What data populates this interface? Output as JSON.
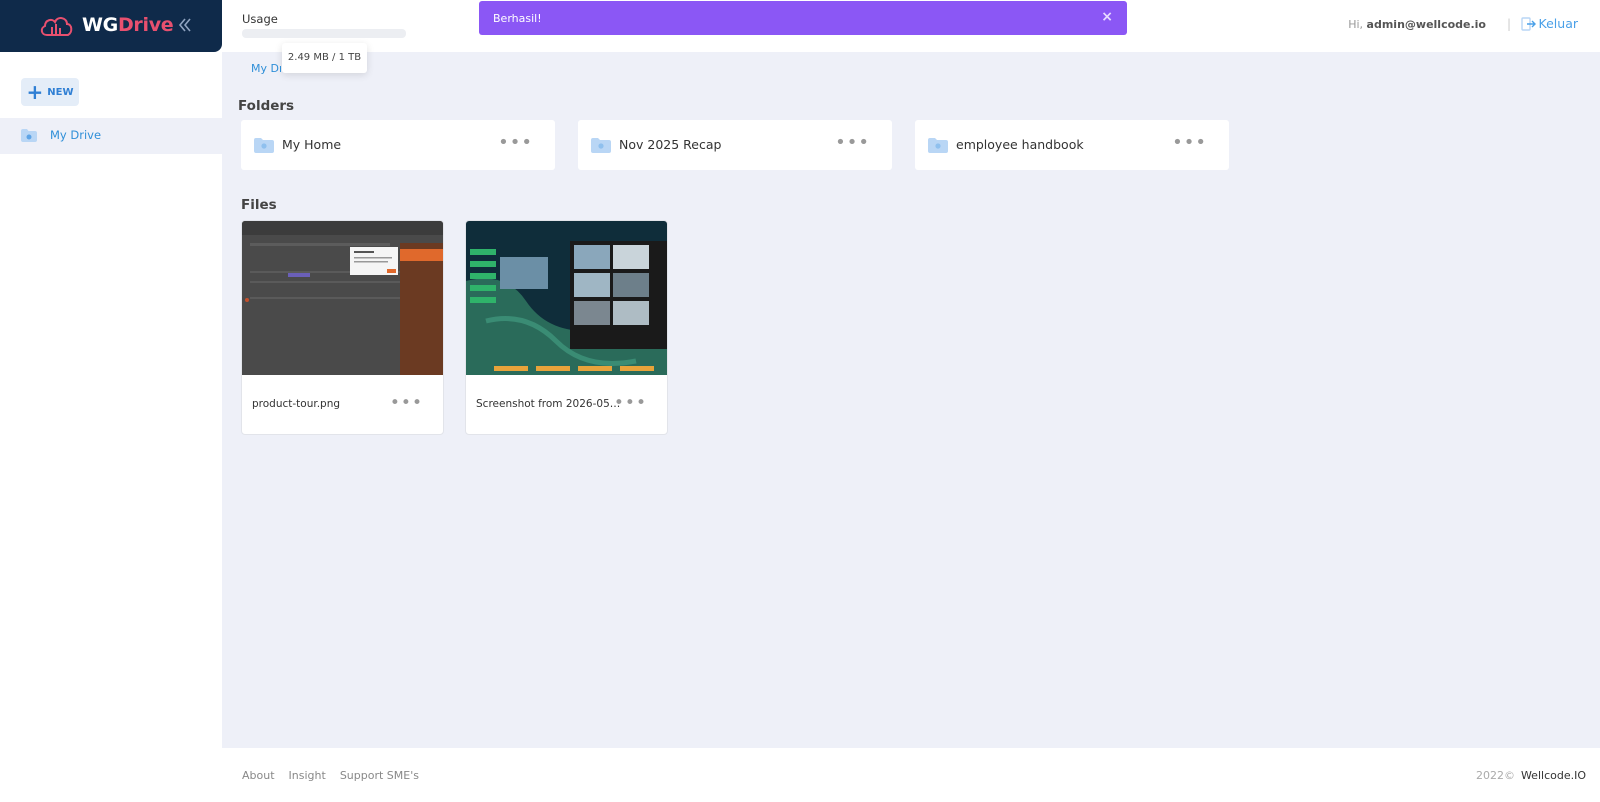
{
  "brand": {
    "name_main": "WG",
    "name_accent": "Drive"
  },
  "sidebar": {
    "new_label": "NEW",
    "items": [
      {
        "label": "My Drive",
        "active": true
      }
    ]
  },
  "topbar": {
    "usage_label": "Usage",
    "usage_tooltip": "2.49 MB / 1 TB",
    "usage_fraction": 2.4e-06,
    "greeting_prefix": "Hi,",
    "user_email": "admin@wellcode.io",
    "divider": "|",
    "logout_label": "Keluar"
  },
  "toast": {
    "message": "Berhasil!",
    "close": "×"
  },
  "breadcrumb": "My Drive",
  "folders": {
    "title": "Folders",
    "items": [
      {
        "name": "My Home"
      },
      {
        "name": "Nov 2025 Recap"
      },
      {
        "name": "employee handbook"
      }
    ]
  },
  "files": {
    "title": "Files",
    "items": [
      {
        "name": "product-tour.png"
      },
      {
        "name": "Screenshot from 2026-05-1..."
      }
    ]
  },
  "more_glyph": "•••",
  "footer": {
    "links": [
      "About",
      "Insight",
      "Support SME's"
    ],
    "year": "2022©",
    "company": "Wellcode.IO"
  },
  "colors": {
    "brand_bg": "#0f2a4a",
    "accent_pink": "#e8506f",
    "link_blue": "#2f8fd8",
    "toast_purple": "#8b57f5",
    "page_bg": "#eef0f8"
  }
}
